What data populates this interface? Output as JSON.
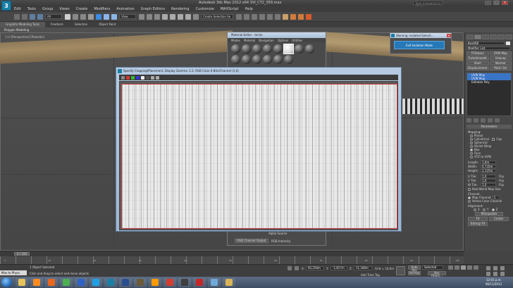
{
  "app": {
    "title": "Autodesk 3ds Max 2012 x64     3VI_CT2_358.max",
    "logo": "3",
    "search_placeholder": "Type a keyword or phrase"
  },
  "menu": [
    "Edit",
    "Tools",
    "Group",
    "Views",
    "Create",
    "Modifiers",
    "Animation",
    "Graph Editors",
    "Rendering",
    "Customize",
    "MAXScript",
    "Help"
  ],
  "toolbar": {
    "selection_filter": "All",
    "view_select": "View",
    "selection_set": "Create Selection Se"
  },
  "ribbon": {
    "tabs": [
      "Graphite Modeling Tools",
      "Freeform",
      "Selection",
      "Object Paint"
    ],
    "active_tab": 0,
    "panel_label": "Polygon Modeling"
  },
  "viewport": {
    "label": "[+] [Perspective] [Realistic]"
  },
  "material_editor": {
    "title": "Material Editor - techo",
    "menu": [
      "Modes",
      "Material",
      "Navigation",
      "Options",
      "Utilities"
    ],
    "bottom_left": "RGB Channel Output",
    "bottom_right": "RGB Intensity",
    "alpha_label": "Alpha Source"
  },
  "warning": {
    "title": "Warning: Isolated Selecti...",
    "button": "Exit Isolation Mode"
  },
  "crop_dialog": {
    "title": "Specify Cropping/Placement, Display Gamma: 2.2, RGB Color 8 Bits/Channel (1:4)"
  },
  "command_panel": {
    "object_name": "Box008",
    "modifier_list": "Modifier List",
    "buttons": [
      [
        "FFD(box)",
        "UVW Map"
      ],
      [
        "TurboSmooth",
        "Unwrap"
      ],
      [
        "Shell",
        "Normal"
      ],
      [
        "Displacement",
        "Mesh Sel"
      ]
    ],
    "stack": [
      {
        "label": "UVW Map",
        "selected": true
      },
      {
        "label": "UVW Map",
        "selected": true
      },
      {
        "label": "Editable Poly",
        "selected": false
      }
    ],
    "rollout": "Parameters",
    "mapping_label": "Mapping:",
    "mapping_options": [
      "Planar",
      "Cylindrical",
      "Spherical",
      "Shrink Wrap",
      "Box",
      "Face",
      "XYZ to UVW"
    ],
    "mapping_selected": 4,
    "cap_label": "Cap",
    "length_label": "Length:",
    "length_value": "1,6m",
    "width_label": "Width:",
    "width_value": "0,735m",
    "height_label": "Height:",
    "height_value": "2,125m",
    "utile_label": "U Tile:",
    "utile_value": "1,0",
    "vtile_label": "V Tile:",
    "vtile_value": "1,0",
    "wtile_label": "W Tile:",
    "wtile_value": "1,0",
    "flip_label": "Flip",
    "real_world": "Real-World Map Size",
    "channel_label": "Channel:",
    "map_channel": "Map Channel:",
    "map_channel_value": "1",
    "vertex_color": "Vertex Color Channel",
    "alignment_label": "Alignment:",
    "axes": [
      "X",
      "Y",
      "Z"
    ],
    "manipulate": "Manipulate",
    "fit": "Fit",
    "center": "Center",
    "bitmap_fit": "Bitmap Fit"
  },
  "timeline": {
    "frame_display": "0 / 100",
    "ticks": [
      "0",
      "5",
      "10",
      "15",
      "20",
      "25",
      "30",
      "35",
      "40",
      "45",
      "50",
      "55",
      "60",
      "65",
      "70",
      "75",
      "80",
      "85",
      "90",
      "95",
      "100"
    ]
  },
  "status": {
    "selection": "1 Object Selected",
    "prompt": "Click and drag to select and move objects",
    "x_label": "X:",
    "x_value": "65,256m",
    "y_label": "Y:",
    "y_value": "-1,817m",
    "z_label": "Z:",
    "z_value": "11,346m",
    "grid": "Grid = 10,0m",
    "auto_key": "Auto Key",
    "key_mode": "Selected",
    "set_key": "Set Key",
    "key_filters": "Key Filters...",
    "add_time_tag": "Add Time Tag",
    "maxscript": "Welcome to MAXScript.",
    "maxscript_short": "Max to Physc"
  },
  "taskbar": {
    "time": "12:01 p.m.",
    "date": "06/11/2013",
    "apps": [
      {
        "name": "explorer-icon",
        "color": "#e7c35a"
      },
      {
        "name": "media-player-icon",
        "color": "#ff8a1f"
      },
      {
        "name": "firefox-icon",
        "color": "#e8661e"
      },
      {
        "name": "chrome-icon",
        "color": "#4caf50"
      },
      {
        "name": "word-icon",
        "color": "#2f62c7"
      },
      {
        "name": "skype-icon",
        "color": "#1ea0e6"
      },
      {
        "name": "3dsmax-icon",
        "color": "#1a7fa5"
      },
      {
        "name": "photoshop-icon",
        "color": "#2a4f8f"
      },
      {
        "name": "bridge-icon",
        "color": "#6a5a3a"
      },
      {
        "name": "illustrator-icon",
        "color": "#ff9a00"
      },
      {
        "name": "autocad-icon",
        "color": "#d63b2f"
      },
      {
        "name": "vray-icon",
        "color": "#3f3f3f"
      },
      {
        "name": "acrobat-icon",
        "color": "#c62828"
      },
      {
        "name": "paint-icon",
        "color": "#6fa9d8"
      },
      {
        "name": "folder-icon",
        "color": "#d9b457"
      }
    ]
  }
}
